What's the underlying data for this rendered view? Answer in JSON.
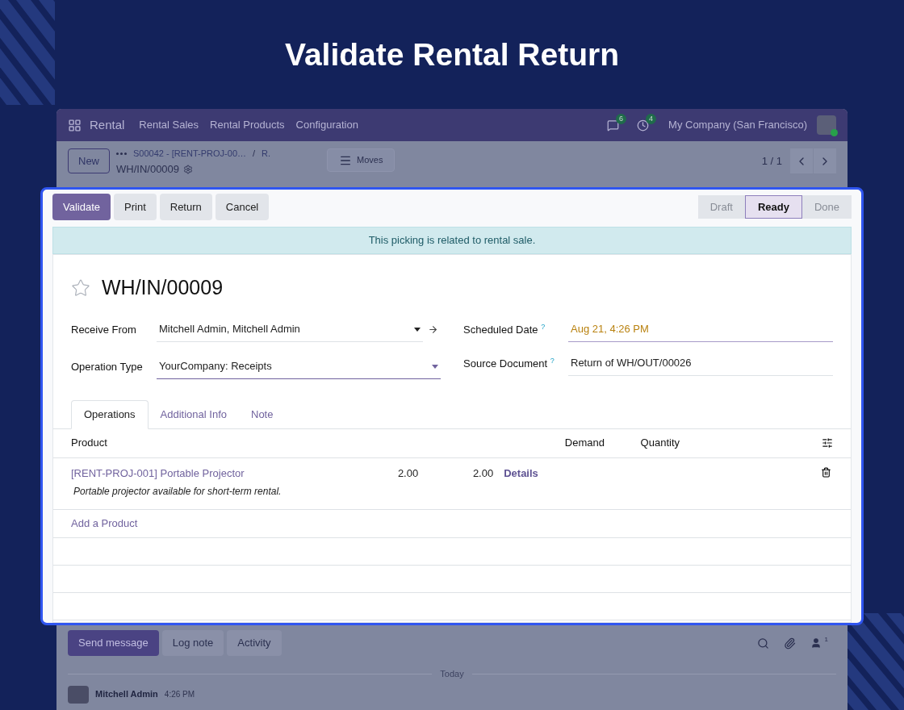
{
  "heading": "Validate Rental Return",
  "navbar": {
    "app": "Rental",
    "menu": [
      "Rental Sales",
      "Rental Products",
      "Configuration"
    ],
    "messages_count": "6",
    "activities_count": "4",
    "company": "My Company (San Francisco)"
  },
  "control_panel": {
    "new_button": "New",
    "breadcrumb": [
      "S00042 - [RENT-PROJ-00…",
      "R."
    ],
    "separator": "/",
    "record": "WH/IN/00009",
    "moves_button": "Moves",
    "pager": "1 / 1"
  },
  "actions": [
    {
      "label": "Validate",
      "primary": true
    },
    {
      "label": "Print",
      "primary": false
    },
    {
      "label": "Return",
      "primary": false
    },
    {
      "label": "Cancel",
      "primary": false
    }
  ],
  "status": [
    {
      "label": "Draft",
      "selected": false
    },
    {
      "label": "Ready",
      "selected": true
    },
    {
      "label": "Done",
      "selected": false
    }
  ],
  "alert": "This picking is related to rental sale.",
  "record": {
    "title": "WH/IN/00009",
    "starred": false
  },
  "fields_left": [
    {
      "label": "Receive From",
      "value": "Mitchell Admin, Mitchell Admin",
      "kind": "link"
    },
    {
      "label": "Operation Type",
      "value": "YourCompany: Receipts",
      "kind": "select"
    }
  ],
  "fields_right": [
    {
      "label": "Scheduled Date",
      "help": "?",
      "value": "Aug 21, 4:26 PM",
      "warning": true
    },
    {
      "label": "Source Document",
      "help": "?",
      "value": "Return of WH/OUT/00026",
      "warning": false
    }
  ],
  "tabs": [
    {
      "label": "Operations",
      "selected": true
    },
    {
      "label": "Additional Info",
      "selected": false
    },
    {
      "label": "Note",
      "selected": false
    }
  ],
  "table": {
    "columns": [
      "Product",
      "Demand",
      "Quantity"
    ],
    "rows": [
      {
        "product": "[RENT-PROJ-001] Portable Projector",
        "description": "Portable projector available for short-term rental.",
        "demand": "2.00",
        "quantity": "2.00",
        "action": "Details"
      }
    ],
    "add_line": "Add a Product"
  },
  "chatter": {
    "buttons": [
      {
        "label": "Send message",
        "primary": true
      },
      {
        "label": "Log note",
        "primary": false
      },
      {
        "label": "Activity",
        "primary": false
      }
    ],
    "followers_count": "1",
    "divider": "Today",
    "message": {
      "author": "Mitchell Admin",
      "time": "4:26 PM"
    }
  }
}
